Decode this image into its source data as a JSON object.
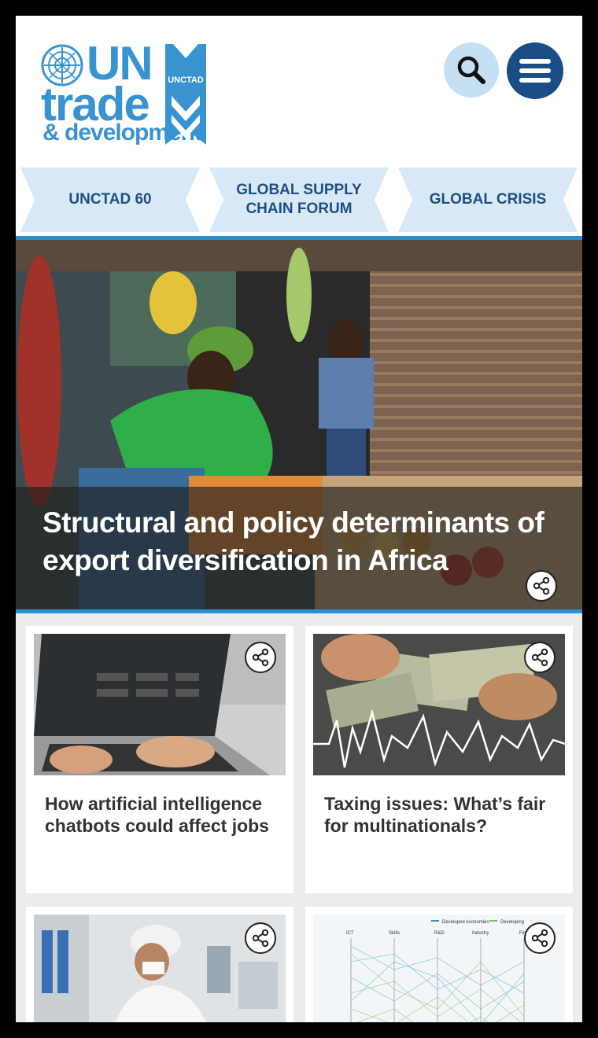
{
  "brand": {
    "line1": "UN",
    "line2": "trade",
    "line3": "& development",
    "mark_text": "UNCTAD",
    "color": "#3a93d1"
  },
  "header": {
    "search_icon": "search-icon",
    "menu_icon": "hamburger-menu-icon"
  },
  "nav": {
    "items": [
      {
        "label": "UNCTAD 60"
      },
      {
        "label": "GLOBAL SUPPLY CHAIN FORUM"
      },
      {
        "label": "GLOBAL CRISIS"
      }
    ]
  },
  "hero": {
    "title": "Structural and policy determinants of export diversification in Africa",
    "share_icon": "share-icon"
  },
  "cards": [
    {
      "title": "How artificial intelligence chatbots could affect jobs",
      "image": "laptop-chatgpt-photo"
    },
    {
      "title": "Taxing issues: What’s fair for multinationals?",
      "image": "dollar-bills-photo"
    },
    {
      "title": "",
      "image": "lab-worker-photo"
    },
    {
      "title": "",
      "image": "parallel-coordinates-chart-image"
    }
  ],
  "chart_thumb": {
    "legend": [
      "Developed economies",
      "Developing"
    ],
    "axes": [
      "ICT",
      "Skills",
      "R&D",
      "Industry",
      "Fin"
    ]
  },
  "colors": {
    "accent_blue": "#2b8fd6",
    "nav_bg": "#d7e8f6",
    "nav_text": "#1f4f82",
    "menu_button": "#1a4d86",
    "search_button": "#c6e0f3"
  }
}
